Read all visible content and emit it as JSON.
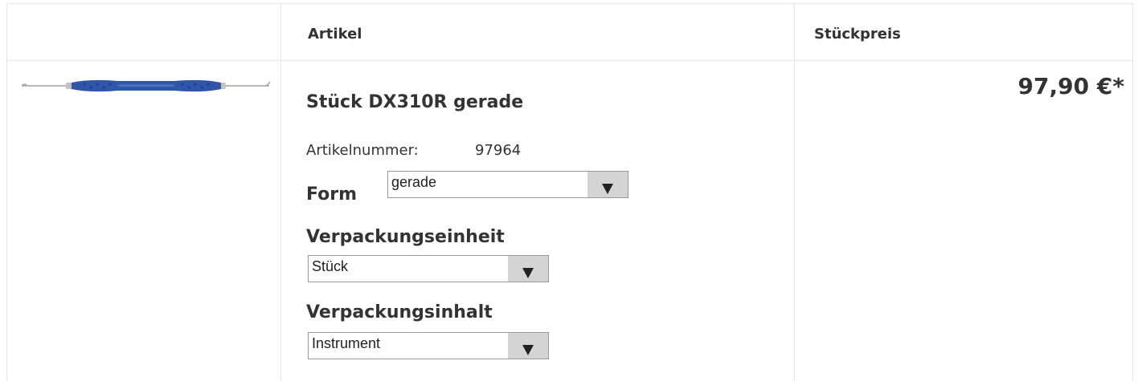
{
  "columns": {
    "article": "Artikel",
    "unit_price": "Stückpreis"
  },
  "product": {
    "title": "Stück DX310R gerade",
    "sku_label": "Artikelnummer:",
    "sku_value": "97964",
    "price": "97,90 €*",
    "image_alt": "dental-instrument-image"
  },
  "options": {
    "form": {
      "label": "Form",
      "selected": "gerade"
    },
    "packaging_unit": {
      "label": "Verpackungseinheit",
      "selected": "Stück"
    },
    "packaging_content": {
      "label": "Verpackungsinhalt",
      "selected": "Instrument"
    }
  },
  "colors": {
    "border": "#e6e6e6",
    "text": "#333333",
    "instrument_handle": "#2f56a8",
    "select_arrow_bg": "#d4d4d4"
  }
}
